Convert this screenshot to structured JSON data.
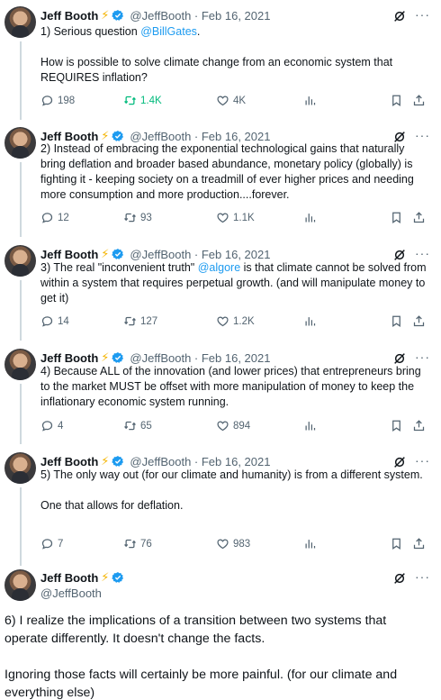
{
  "tweets": [
    {
      "name": "Jeff Booth",
      "handle_date": "@JeffBooth · Feb 16, 2021",
      "text_pre": "1) Serious question ",
      "mention": "@BillGates",
      "text_post": ".\n\nHow is possible to solve climate change from an economic system that REQUIRES inflation?",
      "replies": "198",
      "retweets": "1.4K",
      "likes": "4K",
      "retweeted": true
    },
    {
      "name": "Jeff Booth",
      "handle_date": "@JeffBooth · Feb 16, 2021",
      "text_pre": "2) Instead of embracing the exponential technological gains that naturally bring deflation and broader based abundance, monetary policy (globally) is fighting it - keeping society on a treadmill of ever higher prices and needing more consumption and more production....forever.",
      "mention": "",
      "text_post": "",
      "replies": "12",
      "retweets": "93",
      "likes": "1.1K",
      "retweeted": false
    },
    {
      "name": "Jeff Booth",
      "handle_date": "@JeffBooth · Feb 16, 2021",
      "text_pre": "3) The real \"inconvenient truth\" ",
      "mention": "@algore",
      "text_post": " is that climate cannot be solved from within a system that requires perpetual growth. (and will manipulate money to get it)",
      "replies": "14",
      "retweets": "127",
      "likes": "1.2K",
      "retweeted": false
    },
    {
      "name": "Jeff Booth",
      "handle_date": "@JeffBooth · Feb 16, 2021",
      "text_pre": "4) Because ALL of the innovation (and lower prices) that entrepreneurs bring to the market MUST be offset with more manipulation of money to keep the inflationary economic system running.",
      "mention": "",
      "text_post": "",
      "replies": "4",
      "retweets": "65",
      "likes": "894",
      "retweeted": false
    },
    {
      "name": "Jeff Booth",
      "handle_date": "@JeffBooth · Feb 16, 2021",
      "text_pre": "5) The only way out (for our climate and humanity) is from a different system.\n\nOne that allows for deflation.",
      "mention": "",
      "text_post": "",
      "replies": "7",
      "retweets": "76",
      "likes": "983",
      "retweeted": false
    }
  ],
  "main_tweet": {
    "name": "Jeff Booth",
    "handle": "@JeffBooth",
    "text": "6) I realize the implications of a transition between two systems that operate differently. It doesn't change the facts.\n\nIgnoring those facts will certainly be more painful. (for our climate and everything else)"
  },
  "colors": {
    "accent": "#1d9bf0",
    "retweet_active": "#00ba7c",
    "muted": "#536471",
    "bolt": "#f4b400"
  },
  "icons": [
    "reply-icon",
    "retweet-icon",
    "like-icon",
    "views-icon",
    "bookmark-icon",
    "share-icon",
    "grok-icon",
    "more-icon",
    "verified-badge-icon",
    "lightning-icon"
  ]
}
